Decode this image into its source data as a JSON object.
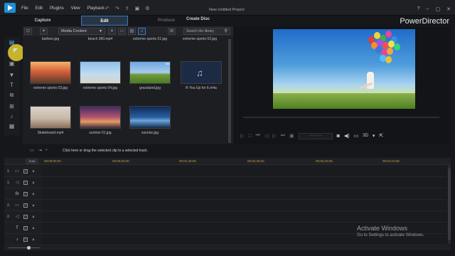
{
  "window": {
    "document_title": "New Untitled Project",
    "brand": "PowerDirector",
    "menu": [
      "File",
      "Edit",
      "Plugins",
      "View",
      "Playback"
    ],
    "controls": {
      "help": "?",
      "minimize": "–",
      "maximize": "▢",
      "close": "✕"
    }
  },
  "modes": {
    "capture": "Capture",
    "edit": "Edit",
    "produce": "Produce",
    "create_disc": "Create Disc"
  },
  "library": {
    "dropdown_value": "Media Content",
    "search_placeholder": "Search the library",
    "items": [
      {
        "caption": "balloon.jpg",
        "visual": "partial",
        "badge": ""
      },
      {
        "caption": "beach 360.mp4",
        "visual": "partial",
        "badge": ""
      },
      {
        "caption": "extreme sports 01.jpg",
        "visual": "partial",
        "badge": ""
      },
      {
        "caption": "extreme sports 02.jpg",
        "visual": "partial",
        "badge": ""
      },
      {
        "caption": "extreme sports 03.jpg",
        "visual": "sunset1",
        "badge": ""
      },
      {
        "caption": "extreme sports 04.jpg",
        "visual": "sky1",
        "badge": ""
      },
      {
        "caption": "grassland.jpg",
        "visual": "grass",
        "badge": "360"
      },
      {
        "caption": "R You Up for It.m4a",
        "visual": "music",
        "badge": ""
      },
      {
        "caption": "Skateboard.mp4",
        "visual": "skate",
        "badge": ""
      },
      {
        "caption": "sunrise 01.jpg",
        "visual": "sunrise1",
        "badge": ""
      },
      {
        "caption": "sunrise.jpg",
        "visual": "sunrise2",
        "badge": ""
      }
    ]
  },
  "preview": {
    "timecode": "--:--:--:--",
    "threed_label": "3D"
  },
  "timeline": {
    "hint": "Click here or drag the selected clip to a selected track.",
    "ruler_button": "0:16",
    "ruler_timecodes": [
      "00;00;00;00",
      "00;00;50;00",
      "00;01;40;00",
      "00;02;30;04",
      "00;03;20;06",
      "00;04;10;08"
    ],
    "tracks": [
      {
        "num": "1.",
        "icon": "video-track-icon",
        "glyph": "▭"
      },
      {
        "num": "1.",
        "icon": "audio-track-icon",
        "glyph": "◁"
      },
      {
        "num": "",
        "icon": "fx-track-icon",
        "glyph": "fx"
      },
      {
        "num": "2.",
        "icon": "video-track-icon",
        "glyph": "▭"
      },
      {
        "num": "2.",
        "icon": "audio-track-icon",
        "glyph": "◁"
      },
      {
        "num": "",
        "icon": "title-track-icon",
        "glyph": "T"
      },
      {
        "num": "",
        "icon": "voice-track-icon",
        "glyph": "♪"
      }
    ]
  },
  "watermark": {
    "line1": "Activate Windows",
    "line2": "Go to Settings to activate Windows."
  },
  "colors": {
    "accent": "#3a7ac0",
    "timecode": "#c49b43",
    "cursor_highlight": "#e2d030"
  }
}
